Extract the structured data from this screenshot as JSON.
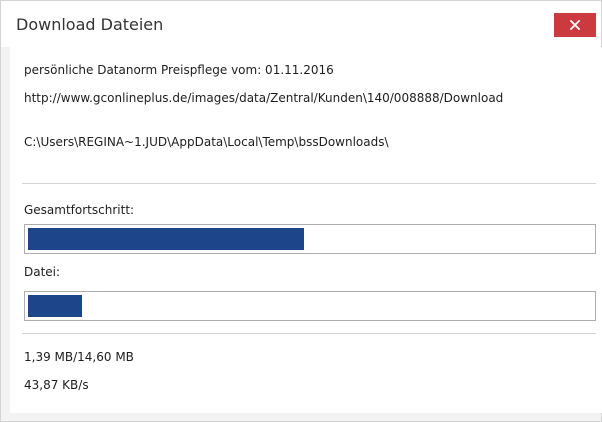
{
  "window": {
    "title": "Download Dateien",
    "close_icon": "close-x-icon",
    "close_color": "#cb3a3f"
  },
  "info": {
    "description": "persönliche Datanorm Preispflege vom: 01.11.2016",
    "url": "http://www.gconlineplus.de/images/data/Zentral/Kunden\\140/008888/Download",
    "local_path": "C:\\Users\\REGINA~1.JUD\\AppData\\Local\\Temp\\bssDownloads\\"
  },
  "progress": {
    "total_label": "Gesamtfortschritt:",
    "total_fraction": 0.49,
    "file_label": "Datei:",
    "file_fraction": 0.095,
    "bar_color": "#1d4589"
  },
  "stats": {
    "size": "1,39 MB/14,60 MB",
    "speed": "43,87 KB/s"
  }
}
